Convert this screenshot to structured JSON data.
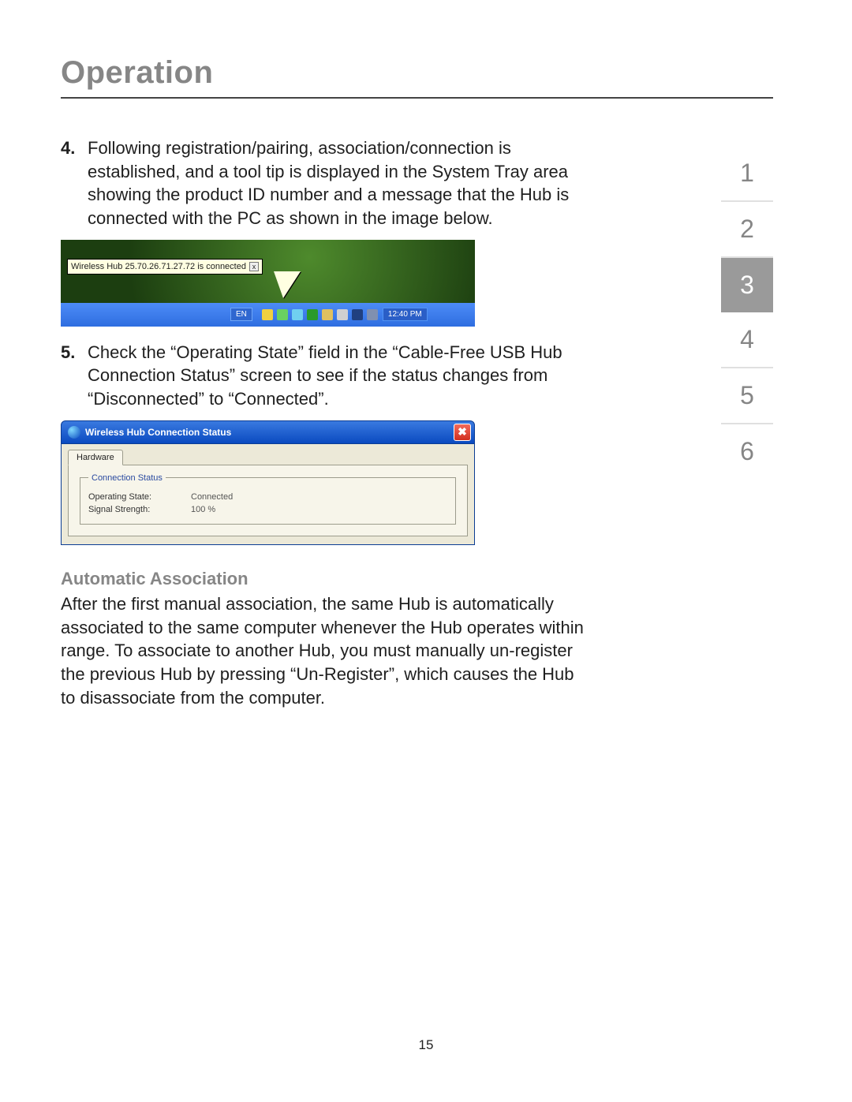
{
  "header": {
    "title": "Operation"
  },
  "sidebar": {
    "items": [
      "1",
      "2",
      "3",
      "4",
      "5",
      "6"
    ],
    "current_index": 2
  },
  "steps": {
    "s4": {
      "num": "4.",
      "text": "Following registration/pairing, association/connection is established, and a tool tip is displayed in the System Tray area showing the product ID number and a message that the Hub is connected with the PC as shown in the image below."
    },
    "s5": {
      "num": "5.",
      "text": "Check the “Operating State” field in the “Cable-Free USB Hub Connection Status” screen to see if the status changes from “Disconnected” to “Connected”."
    }
  },
  "screenshot1": {
    "tooltip_text": "Wireless Hub 25.70.26.71.27.72 is connected",
    "lang_indicator": "EN",
    "clock": "12:40 PM",
    "tray_icon_colors": [
      "#f0d040",
      "#6ad060",
      "#70d0f0",
      "#2a9a2a",
      "#e0c060",
      "#d0d0d0",
      "#204080",
      "#8090b0"
    ]
  },
  "screenshot2": {
    "window_title": "Wireless Hub Connection Status",
    "tab_label": "Hardware",
    "group_label": "Connection Status",
    "op_state_label": "Operating State:",
    "op_state_value": "Connected",
    "signal_label": "Signal Strength:",
    "signal_value": "100 %",
    "close_glyph": "✖"
  },
  "auto_assoc": {
    "heading": "Automatic Association",
    "body": "After the first manual association, the same Hub is automatically associated to the same computer whenever the Hub operates within range. To associate to another Hub, you must manually un-register the previous Hub by pressing “Un-Register”, which causes the Hub to disassociate from the computer."
  },
  "page_number": "15"
}
